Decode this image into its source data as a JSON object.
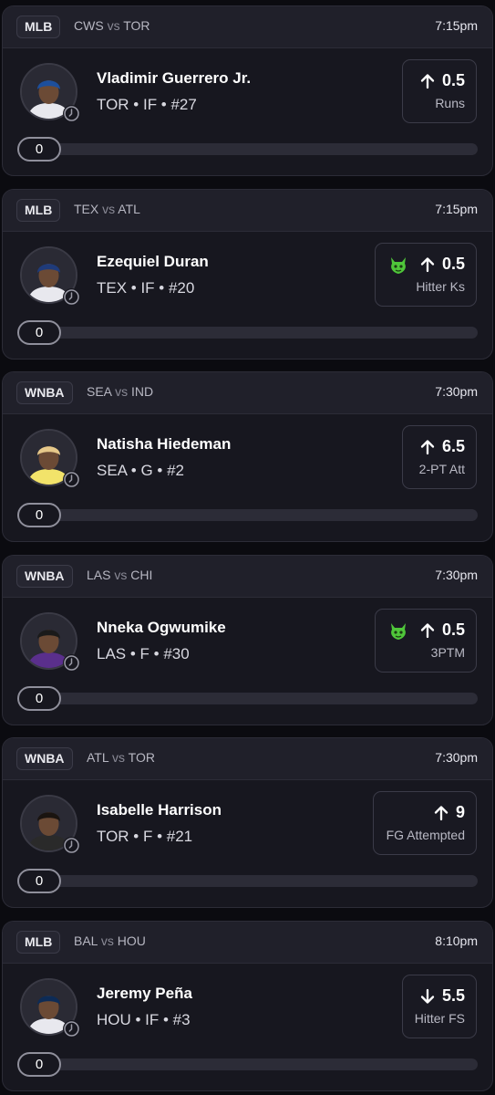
{
  "cards": [
    {
      "league": "MLB",
      "team1": "CWS",
      "vs": "vs",
      "team2": "TOR",
      "time": "7:15pm",
      "player": "Vladimir Guerrero Jr.",
      "meta": "TOR • IF • #27",
      "direction": "up",
      "line": "0.5",
      "stat": "Runs",
      "demon": false,
      "progress": "0",
      "avatar_icon": "player-photo-icon",
      "jersey": "#e8e8ee",
      "cap": "#1d4f9c"
    },
    {
      "league": "MLB",
      "team1": "TEX",
      "vs": "vs",
      "team2": "ATL",
      "time": "7:15pm",
      "player": "Ezequiel Duran",
      "meta": "TEX • IF • #20",
      "direction": "up",
      "line": "0.5",
      "stat": "Hitter Ks",
      "demon": true,
      "progress": "0",
      "avatar_icon": "player-photo-icon",
      "jersey": "#e8e8ee",
      "cap": "#1f3b7a"
    },
    {
      "league": "WNBA",
      "team1": "SEA",
      "vs": "vs",
      "team2": "IND",
      "time": "7:30pm",
      "player": "Natisha Hiedeman",
      "meta": "SEA • G • #2",
      "direction": "up",
      "line": "6.5",
      "stat": "2-PT Att",
      "demon": false,
      "progress": "0",
      "avatar_icon": "player-photo-icon",
      "jersey": "#f2e36a",
      "cap": "#e6c88a"
    },
    {
      "league": "WNBA",
      "team1": "LAS",
      "vs": "vs",
      "team2": "CHI",
      "time": "7:30pm",
      "player": "Nneka Ogwumike",
      "meta": "LAS • F • #30",
      "direction": "up",
      "line": "0.5",
      "stat": "3PTM",
      "demon": true,
      "progress": "0",
      "avatar_icon": "player-photo-icon",
      "jersey": "#5a2f8c",
      "cap": "#1a1a1a"
    },
    {
      "league": "WNBA",
      "team1": "ATL",
      "vs": "vs",
      "team2": "TOR",
      "time": "7:30pm",
      "player": "Isabelle Harrison",
      "meta": "TOR • F • #21",
      "direction": "up",
      "line": "9",
      "stat": "FG Attempted",
      "demon": false,
      "progress": "0",
      "avatar_icon": "player-photo-icon",
      "jersey": "#2a2a2a",
      "cap": "#1a1410"
    },
    {
      "league": "MLB",
      "team1": "BAL",
      "vs": "vs",
      "team2": "HOU",
      "time": "8:10pm",
      "player": "Jeremy Peña",
      "meta": "HOU • IF • #3",
      "direction": "down",
      "line": "5.5",
      "stat": "Hitter FS",
      "demon": false,
      "progress": "0",
      "avatar_icon": "player-photo-icon",
      "jersey": "#e8e8ee",
      "cap": "#0d2b56"
    }
  ],
  "colors": {
    "background": "#0b0b10",
    "card": "#17171f",
    "header": "#20202a",
    "border": "#2c2c37",
    "demon_green": "#4fc63a",
    "track": "#2c2c37"
  },
  "icons": {
    "up": "arrow-up-icon",
    "down": "arrow-down-icon",
    "demon": "demon-icon",
    "clock": "clock-icon"
  }
}
